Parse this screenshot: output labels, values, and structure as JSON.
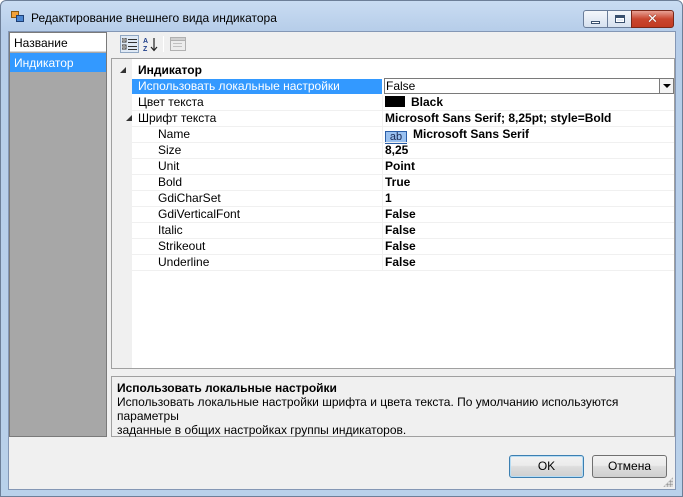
{
  "window": {
    "title": "Редактирование внешнего вида индикатора",
    "caption_buttons": [
      "minimize-icon",
      "maximize-icon",
      "close-icon"
    ]
  },
  "left_panel": {
    "header": "Название",
    "items": [
      {
        "label": "Индикатор",
        "selected": true
      }
    ]
  },
  "toolbar": {
    "buttons": [
      {
        "icon": "categorized-icon",
        "pressed": true
      },
      {
        "icon": "alphabetical-sort-icon",
        "pressed": false
      },
      {
        "icon": "property-pages-icon",
        "pressed": false,
        "enabled": false
      }
    ]
  },
  "property_grid": {
    "category": "Индикатор",
    "rows": [
      {
        "name": "Использовать локальные настройки",
        "value": "False",
        "selected": true,
        "dropdown": true
      },
      {
        "name": "Цвет текста",
        "value": "Black",
        "swatch_color": "#000000"
      },
      {
        "name": "Шрифт текста",
        "value": "Microsoft Sans Serif; 8,25pt; style=Bold",
        "expanded": true
      },
      {
        "name": "Name",
        "value": "Microsoft Sans Serif",
        "preview": "ab",
        "indent": true
      },
      {
        "name": "Size",
        "value": "8,25",
        "indent": true
      },
      {
        "name": "Unit",
        "value": "Point",
        "indent": true
      },
      {
        "name": "Bold",
        "value": "True",
        "indent": true
      },
      {
        "name": "GdiCharSet",
        "value": "1",
        "indent": true
      },
      {
        "name": "GdiVerticalFont",
        "value": "False",
        "indent": true
      },
      {
        "name": "Italic",
        "value": "False",
        "indent": true
      },
      {
        "name": "Strikeout",
        "value": "False",
        "indent": true
      },
      {
        "name": "Underline",
        "value": "False",
        "indent": true
      }
    ]
  },
  "description": {
    "title": "Использовать локальные настройки",
    "line1": "Использовать локальные настройки шрифта и цвета текста. По умолчанию используются параметры",
    "line2": "заданные в общих настройках группы индикаторов."
  },
  "buttons": {
    "ok": "OK",
    "cancel": "Отмена"
  },
  "colors": {
    "selection": "#3399ff",
    "window_frame": "#b9d1ea",
    "close_button": "#c9462f"
  }
}
